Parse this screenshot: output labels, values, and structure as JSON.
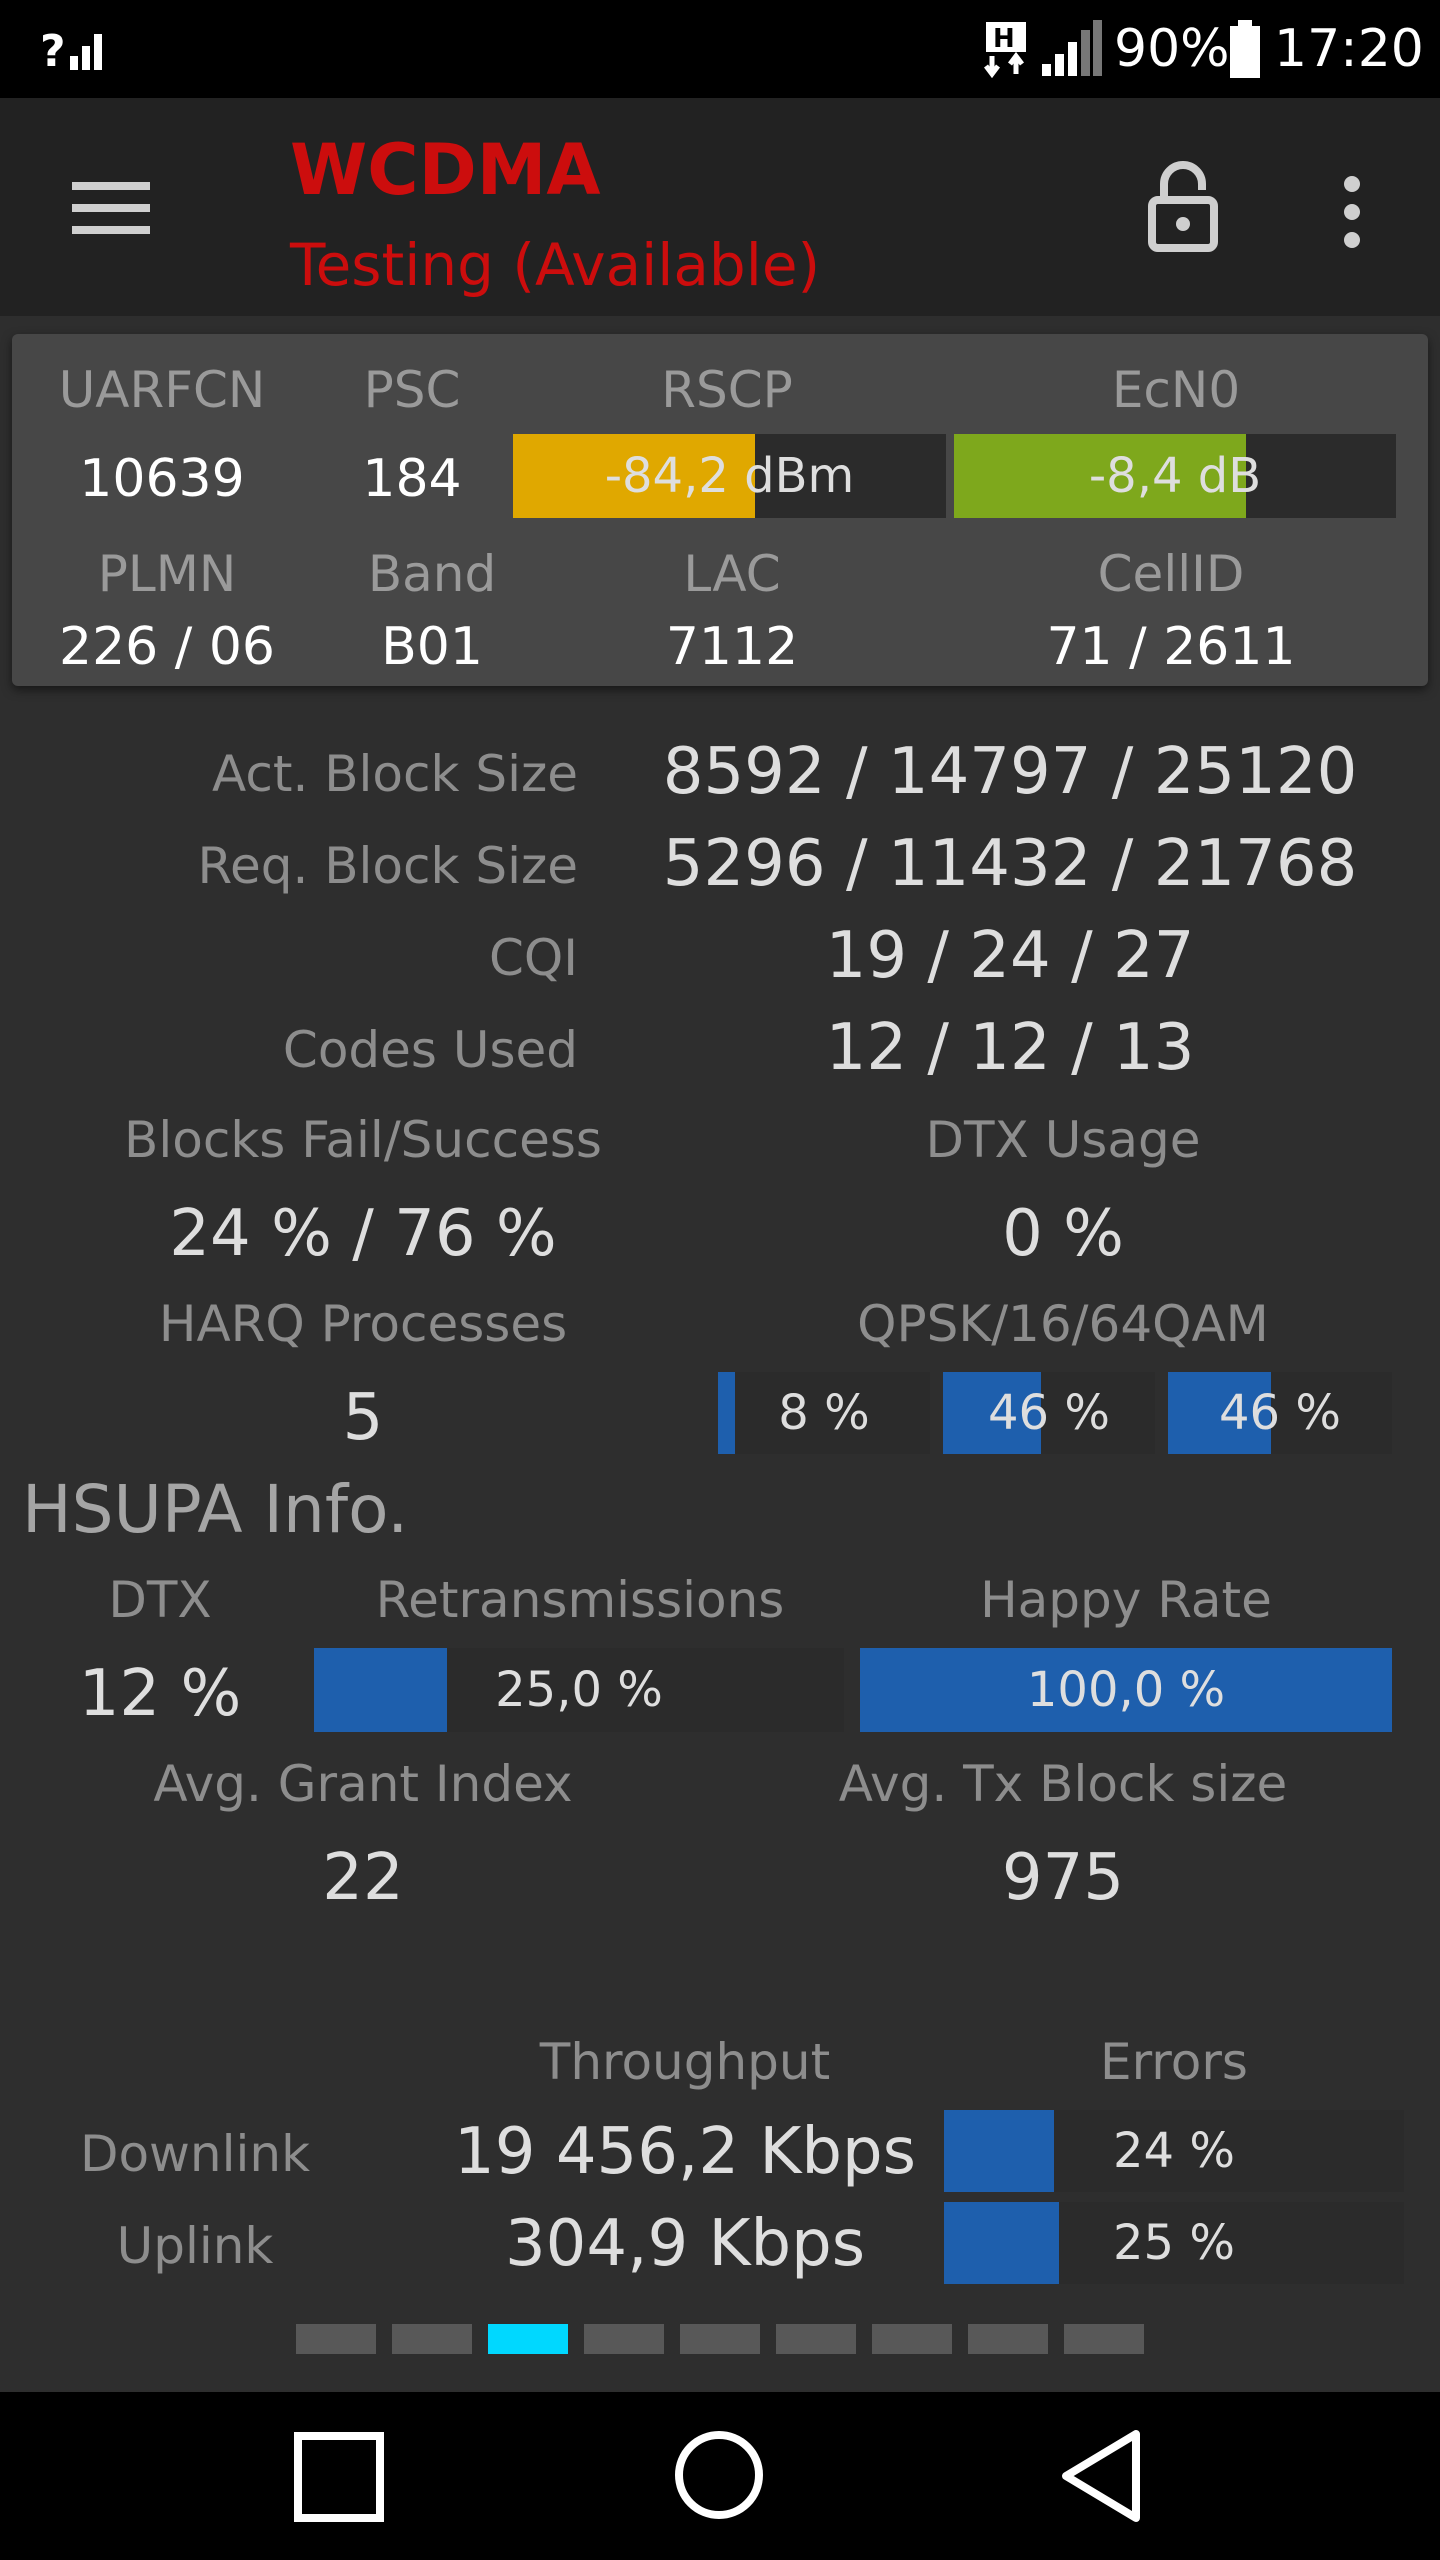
{
  "status_bar": {
    "battery": "90%",
    "time": "17:20"
  },
  "app_bar": {
    "title": "WCDMA",
    "subtitle": "Testing (Available)"
  },
  "cell_info": {
    "uarfcn_label": "UARFCN",
    "uarfcn": "10639",
    "psc_label": "PSC",
    "psc": "184",
    "rscp_label": "RSCP",
    "rscp": "-84,2 dBm",
    "rscp_level": 0.56,
    "rscp_color": "#e0a800",
    "ecn0_label": "EcN0",
    "ecn0": "-8,4 dB",
    "ecn0_level": 0.66,
    "ecn0_color": "#7ea81c",
    "plmn_label": "PLMN",
    "plmn": "226 / 06",
    "band_label": "Band",
    "band": "B01",
    "lac_label": "LAC",
    "lac": "7112",
    "cellid_label": "CellID",
    "cellid": "71 / 2611"
  },
  "hsdpa": {
    "rows": [
      {
        "label": "Act. Block Size",
        "value": "8592 / 14797 / 25120"
      },
      {
        "label": "Req. Block Size",
        "value": "5296 / 11432 / 21768"
      },
      {
        "label": "CQI",
        "value": "19 / 24 / 27"
      },
      {
        "label": "Codes Used",
        "value": "12 / 12 / 13"
      }
    ],
    "blocks_label": "Blocks Fail/Success",
    "blocks_value": "24 % / 76 %",
    "dtx_label": "DTX Usage",
    "dtx_value": "0 %",
    "harq_label": "HARQ Processes",
    "harq_value": "5",
    "qam_label": "QPSK/16/64QAM",
    "qam": [
      {
        "text": "8 %",
        "level": 0.08
      },
      {
        "text": "46 %",
        "level": 0.46
      },
      {
        "text": "46 %",
        "level": 0.46
      }
    ]
  },
  "hsupa": {
    "title": "HSUPA Info.",
    "dtx_label": "DTX",
    "dtx_value": "12 %",
    "retrans_label": "Retransmissions",
    "retrans_value": "25,0 %",
    "retrans_level": 0.25,
    "happy_label": "Happy Rate",
    "happy_value": "100,0 %",
    "happy_level": 1.0,
    "grant_label": "Avg. Grant Index",
    "grant_value": "22",
    "txblock_label": "Avg. Tx Block size",
    "txblock_value": "975"
  },
  "throughput": {
    "throughput_label": "Throughput",
    "errors_label": "Errors",
    "downlink_label": "Downlink",
    "downlink_value": "19 456,2 Kbps",
    "downlink_errors": "24 %",
    "downlink_error_level": 0.24,
    "uplink_label": "Uplink",
    "uplink_value": "304,9 Kbps",
    "uplink_errors": "25 %",
    "uplink_error_level": 0.25
  },
  "pager": {
    "count": 9,
    "active_index": 2,
    "active_color": "#00d8ff"
  },
  "colors": {
    "accent_red": "#cc0d0d",
    "bar_blue": "#1e5fad"
  },
  "icons": [
    "signal-unknown-icon",
    "hplus-data-icon",
    "cell-signal-icon",
    "battery-icon",
    "hamburger-menu-icon",
    "unlock-icon",
    "overflow-menu-icon",
    "recents-icon",
    "home-icon",
    "back-icon"
  ]
}
